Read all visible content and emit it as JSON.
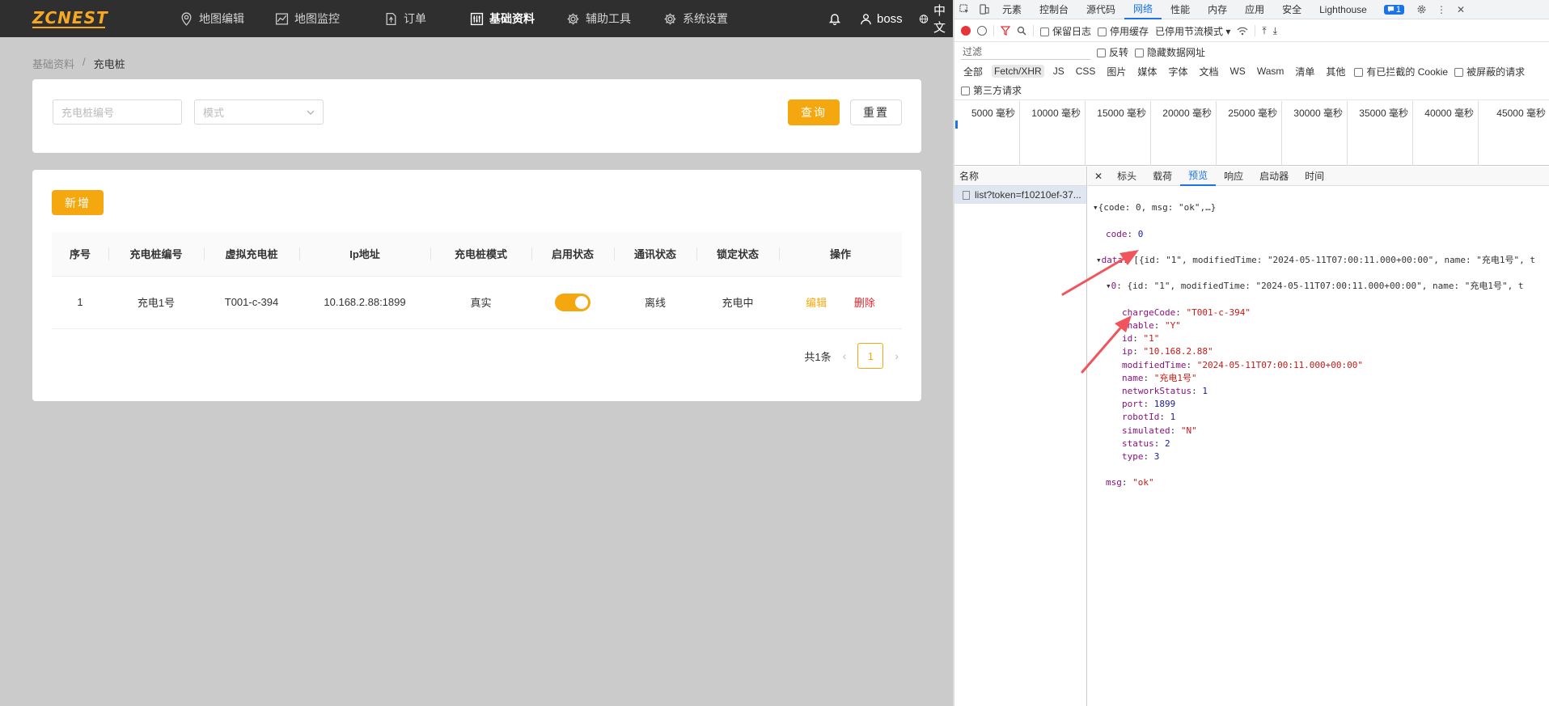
{
  "app": {
    "logo": "ZCNEST",
    "nav": [
      {
        "label": "地图编辑",
        "icon": "map-pin-icon"
      },
      {
        "label": "地图监控",
        "icon": "chart-line-icon"
      },
      {
        "label": "订单",
        "icon": "document-icon"
      },
      {
        "label": "基础资料",
        "icon": "sliders-icon",
        "active": true
      },
      {
        "label": "辅助工具",
        "icon": "gear-icon"
      },
      {
        "label": "系统设置",
        "icon": "gear-icon"
      }
    ],
    "user": "boss",
    "language": "中文",
    "breadcrumb": {
      "parent": "基础资料",
      "separator": "/",
      "current": "充电桩"
    },
    "search": {
      "code_placeholder": "充电桩编号",
      "mode_placeholder": "模式",
      "query_label": "查询",
      "reset_label": "重置"
    },
    "add_label": "新增",
    "table": {
      "headers": [
        "序号",
        "充电桩编号",
        "虚拟充电桩",
        "Ip地址",
        "充电桩模式",
        "启用状态",
        "通讯状态",
        "锁定状态",
        "操作"
      ],
      "rows": [
        {
          "index": "1",
          "code": "充电1号",
          "virtual": "T001-c-394",
          "ip": "10.168.2.88:1899",
          "mode": "真实",
          "enabled": true,
          "comm": "离线",
          "lock": "充电中",
          "edit": "编辑",
          "delete": "删除"
        }
      ]
    },
    "pager": {
      "total": "共1条",
      "page": "1"
    },
    "accent": "#f5a70f"
  },
  "devtools": {
    "tabs": [
      "元素",
      "控制台",
      "源代码",
      "网络",
      "性能",
      "内存",
      "应用",
      "安全",
      "Lighthouse"
    ],
    "active_tab": "网络",
    "issues_count": "1",
    "toolbar": {
      "preserve_log": "保留日志",
      "disable_cache": "停用缓存",
      "throttle": "已停用节流模式"
    },
    "filter": {
      "placeholder": "过滤",
      "invert": "反转",
      "hide_data_urls": "隐藏数据网址"
    },
    "types": [
      "全部",
      "Fetch/XHR",
      "JS",
      "CSS",
      "图片",
      "媒体",
      "字体",
      "文档",
      "WS",
      "Wasm",
      "清单",
      "其他"
    ],
    "active_type": "Fetch/XHR",
    "blocked_cookies": "有已拦截的 Cookie",
    "blocked_requests": "被屏蔽的请求",
    "third_party": "第三方请求",
    "timeline": [
      "5000 毫秒",
      "10000 毫秒",
      "15000 毫秒",
      "20000 毫秒",
      "25000 毫秒",
      "30000 毫秒",
      "35000 毫秒",
      "40000 毫秒",
      "45000 毫秒"
    ],
    "name_header": "名称",
    "request": "list?token=f10210ef-37...",
    "detail_tabs": [
      "标头",
      "载荷",
      "预览",
      "响应",
      "启动器",
      "时间"
    ],
    "active_detail_tab": "预览",
    "preview": {
      "root": "{code: 0, msg: \"ok\",…}",
      "code": "0",
      "data_summary": "[{id: \"1\", modifiedTime: \"2024-05-11T07:00:11.000+00:00\", name: \"充电1号\", t",
      "item_summary": "{id: \"1\", modifiedTime: \"2024-05-11T07:00:11.000+00:00\", name: \"充电1号\", t",
      "fields": [
        {
          "key": "chargeCode",
          "value": "\"T001-c-394\"",
          "type": "s"
        },
        {
          "key": "enable",
          "value": "\"Y\"",
          "type": "s"
        },
        {
          "key": "id",
          "value": "\"1\"",
          "type": "s"
        },
        {
          "key": "ip",
          "value": "\"10.168.2.88\"",
          "type": "s"
        },
        {
          "key": "modifiedTime",
          "value": "\"2024-05-11T07:00:11.000+00:00\"",
          "type": "s"
        },
        {
          "key": "name",
          "value": "\"充电1号\"",
          "type": "s"
        },
        {
          "key": "networkStatus",
          "value": "1",
          "type": "n"
        },
        {
          "key": "port",
          "value": "1899",
          "type": "n"
        },
        {
          "key": "robotId",
          "value": "1",
          "type": "n"
        },
        {
          "key": "simulated",
          "value": "\"N\"",
          "type": "s"
        },
        {
          "key": "status",
          "value": "2",
          "type": "n"
        },
        {
          "key": "type",
          "value": "3",
          "type": "n"
        }
      ],
      "msg": "\"ok\""
    },
    "annotation_color": "#f2545b"
  }
}
